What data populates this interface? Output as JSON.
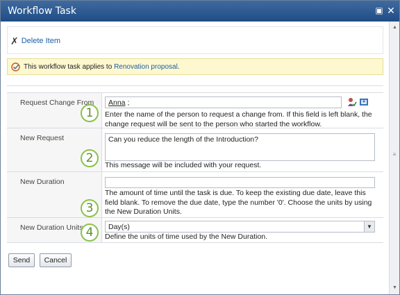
{
  "window": {
    "title": "Workflow Task"
  },
  "ribbon": {
    "delete_label": "Delete Item"
  },
  "notice": {
    "prefix": "This workflow task applies to ",
    "link": "Renovation proposal",
    "suffix": "."
  },
  "form": {
    "request_change_from": {
      "label": "Request Change From",
      "value": "Anna",
      "value_suffix": " ;",
      "number": "1",
      "description": "Enter the name of the person to request a change from. If this field is left blank, the change request will be sent to the person who started the workflow."
    },
    "new_request": {
      "label": "New Request",
      "value": "Can you reduce the length of the Introduction?",
      "number": "2",
      "description": "This message will be included with your request."
    },
    "new_duration": {
      "label": "New Duration",
      "value": "",
      "number": "3",
      "description": "The amount of time until the task is due. To keep the existing due date, leave this field blank. To remove the due date, type the number '0'. Choose the units by using the New Duration Units."
    },
    "new_duration_units": {
      "label": "New Duration Units",
      "value": "Day(s)",
      "number": "4",
      "description": "Define the units of time used by the New Duration."
    }
  },
  "buttons": {
    "send": "Send",
    "cancel": "Cancel"
  },
  "colors": {
    "titlebar": "#2a5a93",
    "link": "#1c5ea8",
    "notice_bg": "#fdf8d0",
    "number_ring": "#8cc24a"
  }
}
